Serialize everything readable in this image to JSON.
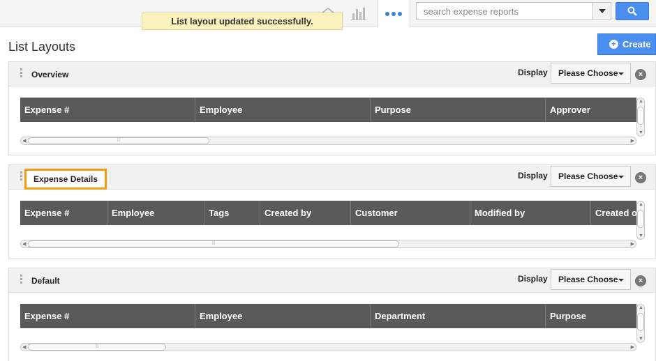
{
  "toast": {
    "message": "List layout updated successfully."
  },
  "search": {
    "placeholder": "search expense reports"
  },
  "page": {
    "title": "List Layouts",
    "create_label": "Create"
  },
  "colors": {
    "accent": "#4a8ef0",
    "highlight": "#f39c12",
    "toast_bg": "#fcf2bd",
    "grid_header": "#5a5a5a"
  },
  "icons": {
    "home": "home-icon",
    "chart": "bar-chart-icon",
    "more": "more-dots-icon",
    "search": "search-icon"
  },
  "panels": [
    {
      "title": "Overview",
      "display_label": "Display",
      "select_value": "Please Choose",
      "columns": [
        "Expense #",
        "Employee",
        "Purpose",
        "Approver"
      ]
    },
    {
      "title": "Expense Details",
      "display_label": "Display",
      "select_value": "Please Choose",
      "columns": [
        "Expense #",
        "Employee",
        "Tags",
        "Created by",
        "Customer",
        "Modified by",
        "Created on"
      ]
    },
    {
      "title": "Default",
      "display_label": "Display",
      "select_value": "Please Choose",
      "columns": [
        "Expense #",
        "Employee",
        "Department",
        "Purpose"
      ]
    }
  ]
}
